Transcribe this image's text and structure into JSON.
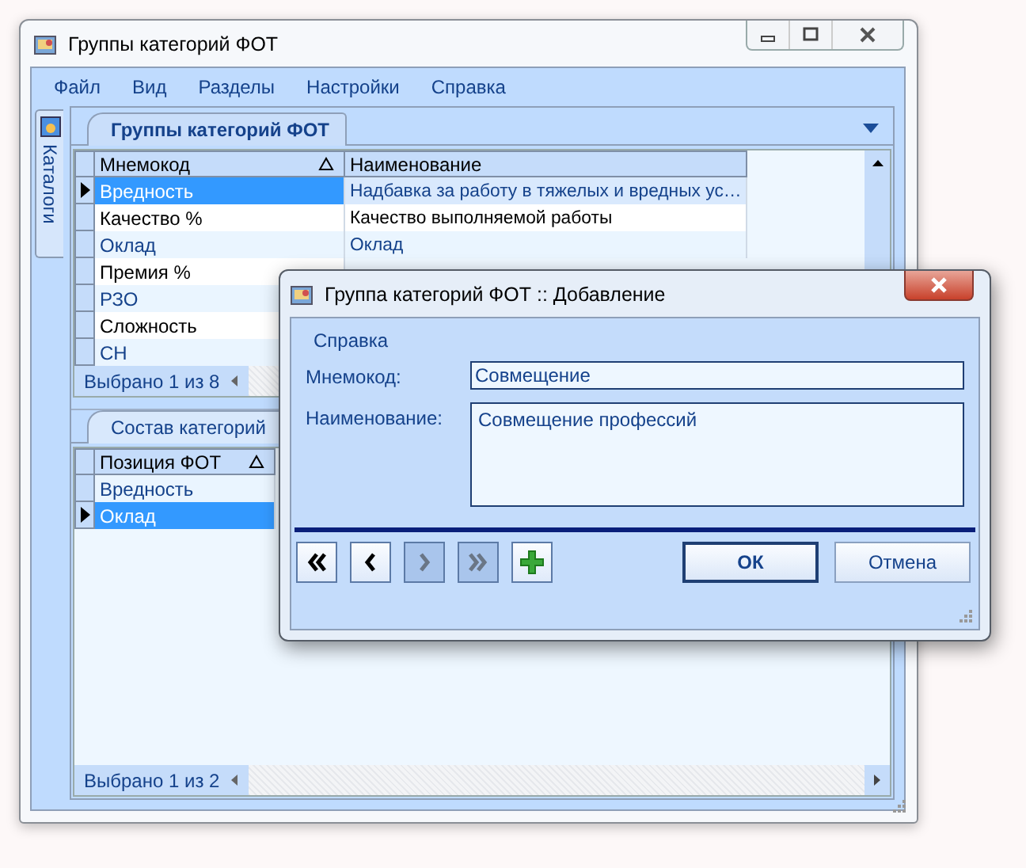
{
  "window": {
    "title": "Группы категорий ФОТ"
  },
  "menu": [
    "Файл",
    "Вид",
    "Разделы",
    "Настройки",
    "Справка"
  ],
  "side_tab": {
    "label": "Каталоги"
  },
  "top_panel": {
    "tab": "Группы категорий ФОТ",
    "columns": [
      {
        "label": "Мнемокод",
        "sorted_ascending": true
      },
      {
        "label": "Наименование",
        "sorted_ascending": false
      }
    ],
    "rows": [
      {
        "cells": [
          "Вредность",
          "Надбавка за работу в тяжелых и вредных ус…"
        ],
        "selected": true
      },
      {
        "cells": [
          "Качество %",
          "Качество выполняемой работы"
        ],
        "selected": false
      },
      {
        "cells": [
          "Оклад",
          "Оклад"
        ],
        "selected": false
      },
      {
        "cells": [
          "Премия %"
        ],
        "selected": false
      },
      {
        "cells": [
          "РЗО"
        ],
        "selected": false
      },
      {
        "cells": [
          "Сложность"
        ],
        "selected": false
      },
      {
        "cells": [
          "СН"
        ],
        "selected": false
      }
    ],
    "status": "Выбрано 1 из 8"
  },
  "bottom_panel": {
    "tab": "Состав категорий",
    "columns": [
      {
        "label": "Позиция ФОТ",
        "sorted_ascending": true
      }
    ],
    "rows": [
      {
        "cells": [
          "Вредность"
        ],
        "selected": false
      },
      {
        "cells": [
          "Оклад"
        ],
        "selected": true
      }
    ],
    "status": "Выбрано 1 из 2"
  },
  "dialog": {
    "title": "Группа категорий ФОТ :: Добавление",
    "menu": [
      "Справка"
    ],
    "fields": [
      {
        "kind": "line",
        "label": "Мнемокод:",
        "value": "Совмещение"
      },
      {
        "kind": "area",
        "label": "Наименование:",
        "value": "Совмещение профессий"
      }
    ],
    "nav": [
      {
        "kind": "first",
        "disabled": false
      },
      {
        "kind": "prev",
        "disabled": false
      },
      {
        "kind": "next",
        "disabled": true
      },
      {
        "kind": "last",
        "disabled": true
      },
      {
        "kind": "add",
        "disabled": false
      }
    ],
    "buttons": [
      {
        "label": "ОК",
        "default": true
      },
      {
        "label": "Отмена",
        "default": false
      }
    ]
  }
}
